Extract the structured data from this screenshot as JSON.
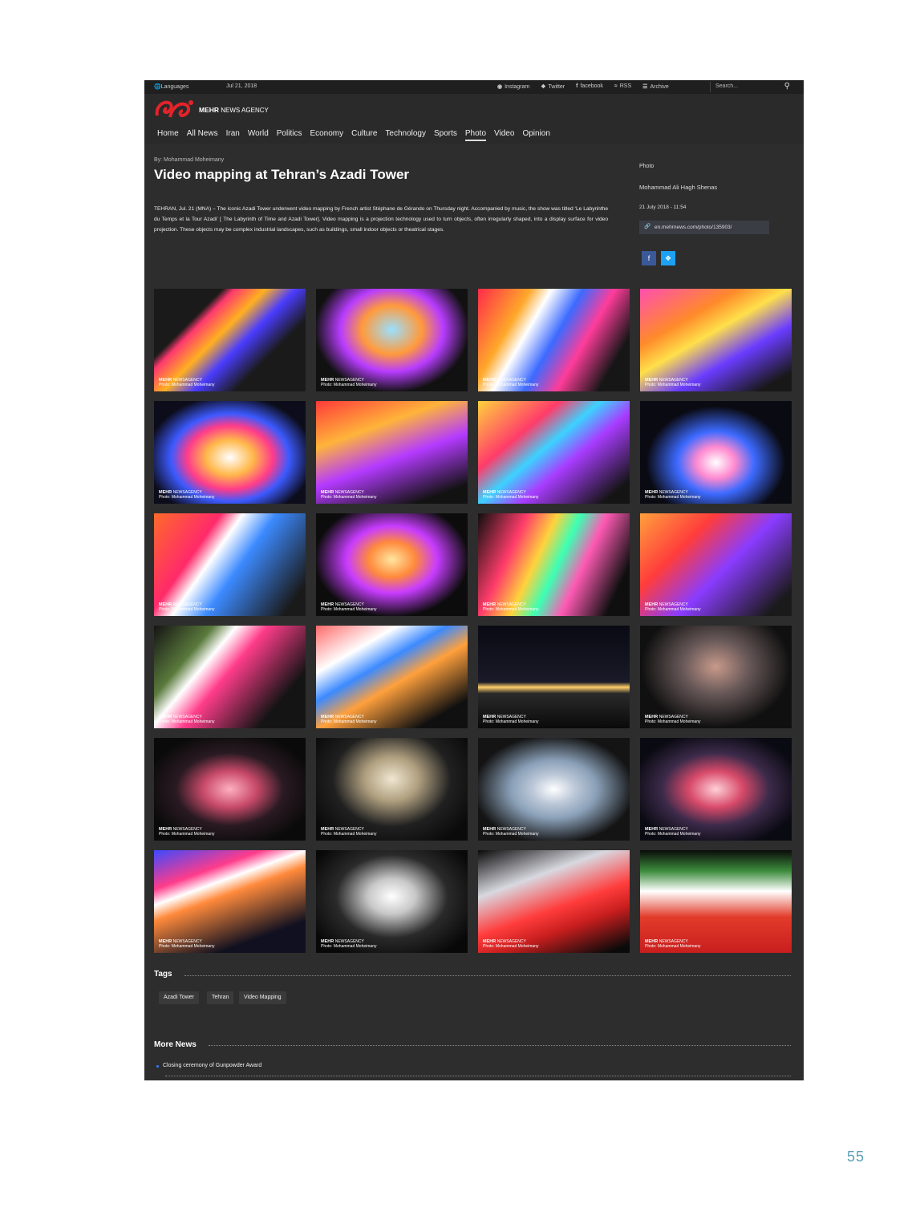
{
  "topbar": {
    "languages": "Languages",
    "date": "Jul 21, 2018",
    "links": [
      "Instagram",
      "Twitter",
      "facebook",
      "RSS",
      "Archive"
    ],
    "search_placeholder": "Search..."
  },
  "logo": {
    "brand": "MEHR",
    "sub": "NEWS AGENCY"
  },
  "nav": [
    "Home",
    "All News",
    "Iran",
    "World",
    "Politics",
    "Economy",
    "Culture",
    "Technology",
    "Sports",
    "Photo",
    "Video",
    "Opinion"
  ],
  "nav_active": "Photo",
  "article": {
    "byline": "By: Mohammad Moheimany",
    "title": "Video mapping at Tehran’s Azadi Tower",
    "lead": "TEHRAN, Jul. 21 (MNA) – The iconic Azadi Tower underwent video mapping by French artist Stéphane de Gérando on Thursday night. Accompanied by music, the show was titled ‘Le Labyrinthe du Temps et la Tour Azadi’ [ The Labyrinth of Time and Azadi Tower]. Video mapping is a projection technology used to turn objects, often irregularly shaped, into a display surface for video projection. These objects may be complex industrial landscapes, such as buildings, small indoor objects or theatrical stages."
  },
  "sidebar": {
    "category": "Photo",
    "author": "Mohammad Ali Hagh Shenas",
    "datetime": "21 July 2018 - 11:54",
    "short_link": "en.mehrnews.com/photo/135903/"
  },
  "watermark": {
    "brand": "MEHR",
    "agency": "NEWSAGENCY",
    "credit": "Photo: Mohammad Moheimany"
  },
  "tags_title": "Tags",
  "tags": [
    "Azadi Tower",
    "Tehran",
    "Video Mapping"
  ],
  "more_news_title": "More News",
  "more_news": [
    "Closing ceremony of Gunpowder Award"
  ],
  "page_number": "55",
  "colors": {
    "background": "#2d2d2d",
    "brand_red": "#e3232a",
    "facebook": "#3b5998",
    "twitter": "#1da1f2"
  }
}
